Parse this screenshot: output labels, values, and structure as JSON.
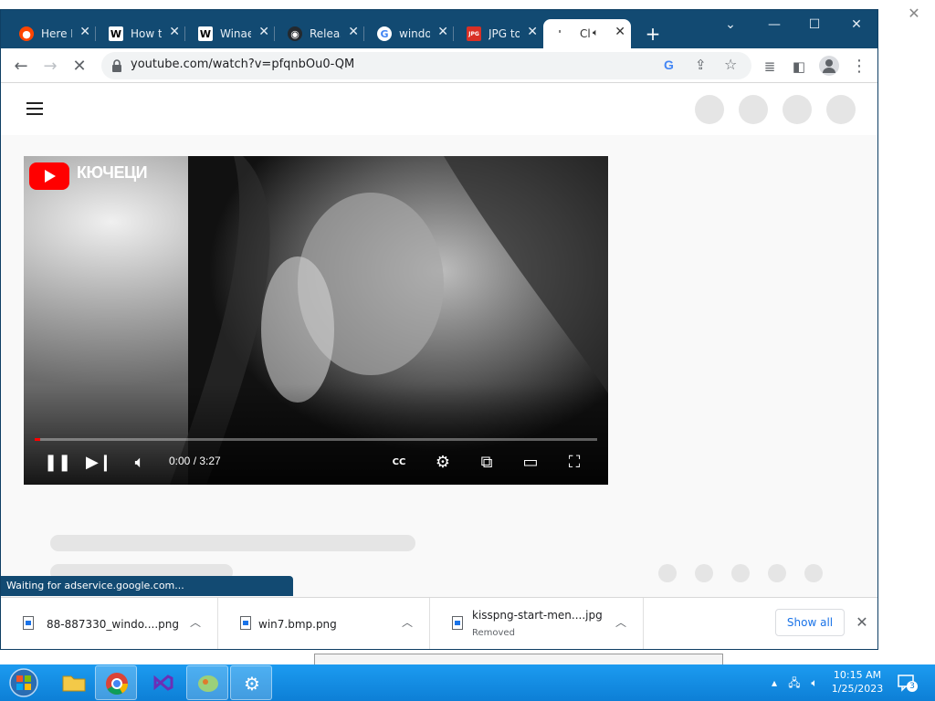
{
  "browser": {
    "tabs": [
      {
        "label": "Here I",
        "icon": "reddit-icon",
        "color": "#ff4500"
      },
      {
        "label": "How t",
        "icon": "wikipedia-icon",
        "color": "#ffffff"
      },
      {
        "label": "Winae",
        "icon": "wikipedia-icon",
        "color": "#ffffff"
      },
      {
        "label": "Releas",
        "icon": "github-icon",
        "color": "#24292e"
      },
      {
        "label": "windo",
        "icon": "google-icon",
        "color": "#ffffff"
      },
      {
        "label": "JPG to",
        "icon": "jpg-png-icon",
        "color": "#d93025"
      },
      {
        "label": "Cl",
        "icon": "loading-icon",
        "color": "#ffffff",
        "active": true,
        "audio": true
      }
    ],
    "new_tab_label": "+",
    "address": "youtube.com/watch?v=pfqnbOu0-QM",
    "status_text": "Waiting for adservice.google.com..."
  },
  "player": {
    "channel": "КЮЧЕЦИ",
    "time": "0:00 / 3:27",
    "progress": 0.01
  },
  "downloads": {
    "items": [
      {
        "name": "88-887330_windo....png",
        "status": ""
      },
      {
        "name": "win7.bmp.png",
        "status": ""
      },
      {
        "name": "kisspng-start-men....jpg",
        "status": "Removed"
      }
    ],
    "show_all": "Show all"
  },
  "taskbar": {
    "time": "10:15 AM",
    "date": "1/25/2023",
    "notification_count": "3"
  },
  "colors": {
    "tabstrip": "#124a72",
    "taskbar": "#1587e0",
    "accent": "#1a73e8",
    "yt_red": "#ff0000"
  }
}
